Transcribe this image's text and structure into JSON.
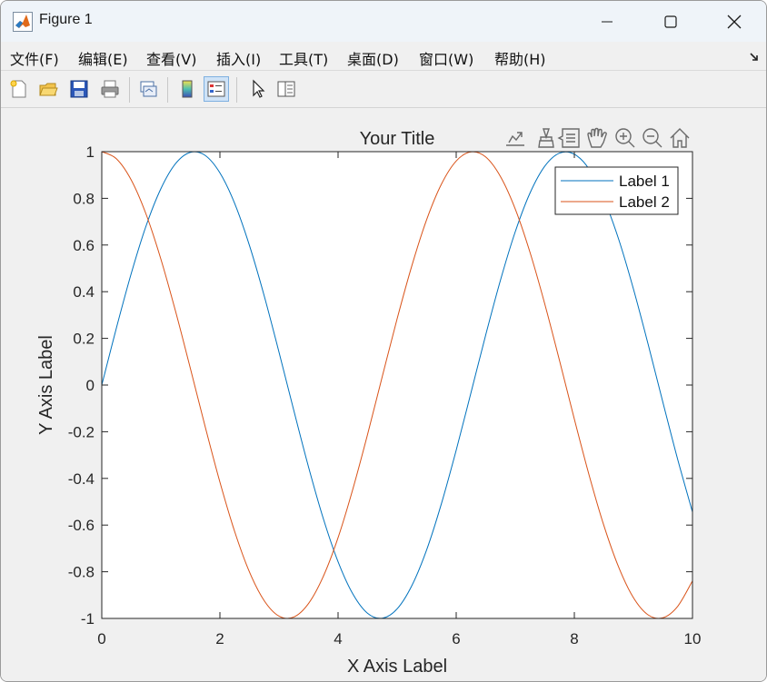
{
  "window": {
    "title": "Figure 1"
  },
  "menu": {
    "items": [
      "文件(F)",
      "编辑(E)",
      "查看(V)",
      "插入(I)",
      "工具(T)",
      "桌面(D)",
      "窗口(W)",
      "帮助(H)"
    ]
  },
  "toolbar": {
    "icons": [
      "new-figure-icon",
      "open-file-icon",
      "save-icon",
      "print-icon",
      "link-plot-icon",
      "insert-colorbar-icon",
      "insert-legend-icon",
      "pointer-icon",
      "property-inspector-icon"
    ]
  },
  "axes_toolbar": {
    "icons": [
      "export-icon",
      "brush-icon",
      "data-tips-icon",
      "pan-hand-icon",
      "zoom-in-icon",
      "zoom-out-icon",
      "home-icon"
    ]
  },
  "colors": {
    "series1": "#0072BD",
    "series2": "#D95319"
  },
  "chart_data": {
    "type": "line",
    "title": "Your Title",
    "xlabel": "X Axis Label",
    "ylabel": "Y Axis Label",
    "xlim": [
      0,
      10
    ],
    "ylim": [
      -1,
      1
    ],
    "xticks": [
      0,
      2,
      4,
      6,
      8,
      10
    ],
    "yticks": [
      -1,
      -0.8,
      -0.6,
      -0.4,
      -0.2,
      0,
      0.2,
      0.4,
      0.6,
      0.8,
      1
    ],
    "xtick_labels": [
      "0",
      "2",
      "4",
      "6",
      "8",
      "10"
    ],
    "ytick_labels": [
      "-1",
      "-0.8",
      "-0.6",
      "-0.4",
      "-0.2",
      "0",
      "0.2",
      "0.4",
      "0.6",
      "0.8",
      "1"
    ],
    "grid": false,
    "legend_position": "top-right",
    "series": [
      {
        "name": "Label 1",
        "color": "#0072BD",
        "x": [
          0,
          0.25,
          0.5,
          0.75,
          1,
          1.25,
          1.5,
          1.75,
          2,
          2.25,
          2.5,
          2.75,
          3,
          3.25,
          3.5,
          3.75,
          4,
          4.25,
          4.5,
          4.75,
          5,
          5.25,
          5.5,
          5.75,
          6,
          6.25,
          6.5,
          6.75,
          7,
          7.25,
          7.5,
          7.75,
          8,
          8.25,
          8.5,
          8.75,
          9,
          9.25,
          9.5,
          9.75,
          10
        ],
        "y": [
          0,
          0.247,
          0.479,
          0.682,
          0.841,
          0.949,
          0.997,
          0.984,
          0.909,
          0.778,
          0.598,
          0.382,
          0.141,
          -0.108,
          -0.351,
          -0.572,
          -0.757,
          -0.895,
          -0.978,
          -0.999,
          -0.959,
          -0.859,
          -0.706,
          -0.508,
          -0.279,
          -0.033,
          0.215,
          0.45,
          0.657,
          0.823,
          0.938,
          0.994,
          0.989,
          0.925,
          0.798,
          0.625,
          0.412,
          0.174,
          -0.075,
          -0.319,
          -0.544
        ]
      },
      {
        "name": "Label 2",
        "color": "#D95319",
        "x": [
          0,
          0.25,
          0.5,
          0.75,
          1,
          1.25,
          1.5,
          1.75,
          2,
          2.25,
          2.5,
          2.75,
          3,
          3.25,
          3.5,
          3.75,
          4,
          4.25,
          4.5,
          4.75,
          5,
          5.25,
          5.5,
          5.75,
          6,
          6.25,
          6.5,
          6.75,
          7,
          7.25,
          7.5,
          7.75,
          8,
          8.25,
          8.5,
          8.75,
          9,
          9.25,
          9.5,
          9.75,
          10
        ],
        "y": [
          1,
          0.969,
          0.878,
          0.732,
          0.54,
          0.315,
          0.071,
          -0.178,
          -0.416,
          -0.628,
          -0.801,
          -0.924,
          -0.99,
          -0.994,
          -0.936,
          -0.82,
          -0.654,
          -0.446,
          -0.211,
          0.038,
          0.284,
          0.512,
          0.709,
          0.861,
          0.96,
          0.999,
          0.977,
          0.893,
          0.754,
          0.568,
          0.347,
          0.104,
          -0.146,
          -0.386,
          -0.602,
          -0.78,
          -0.911,
          -0.985,
          -0.997,
          -0.948,
          -0.839
        ]
      }
    ]
  }
}
